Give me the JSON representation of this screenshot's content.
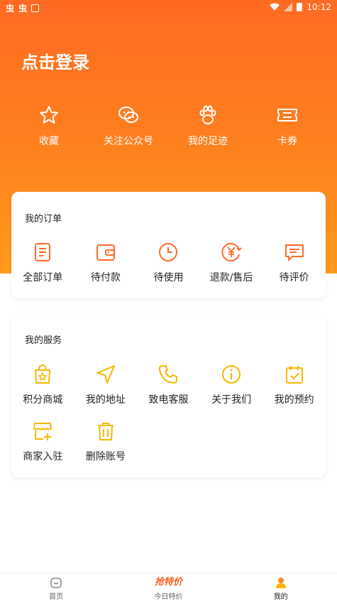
{
  "status": {
    "time": "10:12",
    "left_glyphs": [
      "虫",
      "虫"
    ]
  },
  "header": {
    "login": "点击登录"
  },
  "quick": [
    {
      "label": "收藏",
      "icon": "star-icon"
    },
    {
      "label": "关注公众号",
      "icon": "wechat-icon"
    },
    {
      "label": "我的足迹",
      "icon": "paw-icon"
    },
    {
      "label": "卡券",
      "icon": "ticket-icon"
    }
  ],
  "orders": {
    "title": "我的订单",
    "items": [
      {
        "label": "全部订单",
        "icon": "clipboard-icon"
      },
      {
        "label": "待付款",
        "icon": "wallet-icon"
      },
      {
        "label": "待使用",
        "icon": "clock-icon"
      },
      {
        "label": "退款/售后",
        "icon": "yen-refund-icon"
      },
      {
        "label": "待评价",
        "icon": "comment-icon"
      }
    ]
  },
  "services": {
    "title": "我的服务",
    "items": [
      {
        "label": "积分商城",
        "icon": "shopping-bag-icon"
      },
      {
        "label": "我的地址",
        "icon": "navigation-icon"
      },
      {
        "label": "致电客服",
        "icon": "phone-icon"
      },
      {
        "label": "关于我们",
        "icon": "info-icon"
      },
      {
        "label": "我的预约",
        "icon": "calendar-check-icon"
      },
      {
        "label": "商家入驻",
        "icon": "store-add-icon"
      },
      {
        "label": "删除账号",
        "icon": "trash-icon"
      }
    ]
  },
  "tabbar": {
    "home": "首页",
    "brand": "抢特价",
    "deals": "今日特价",
    "mine": "我的"
  },
  "colors": {
    "accent": "#ff6a22",
    "order_icon": "#ff6a2b",
    "service_icon": "#f5b800"
  }
}
